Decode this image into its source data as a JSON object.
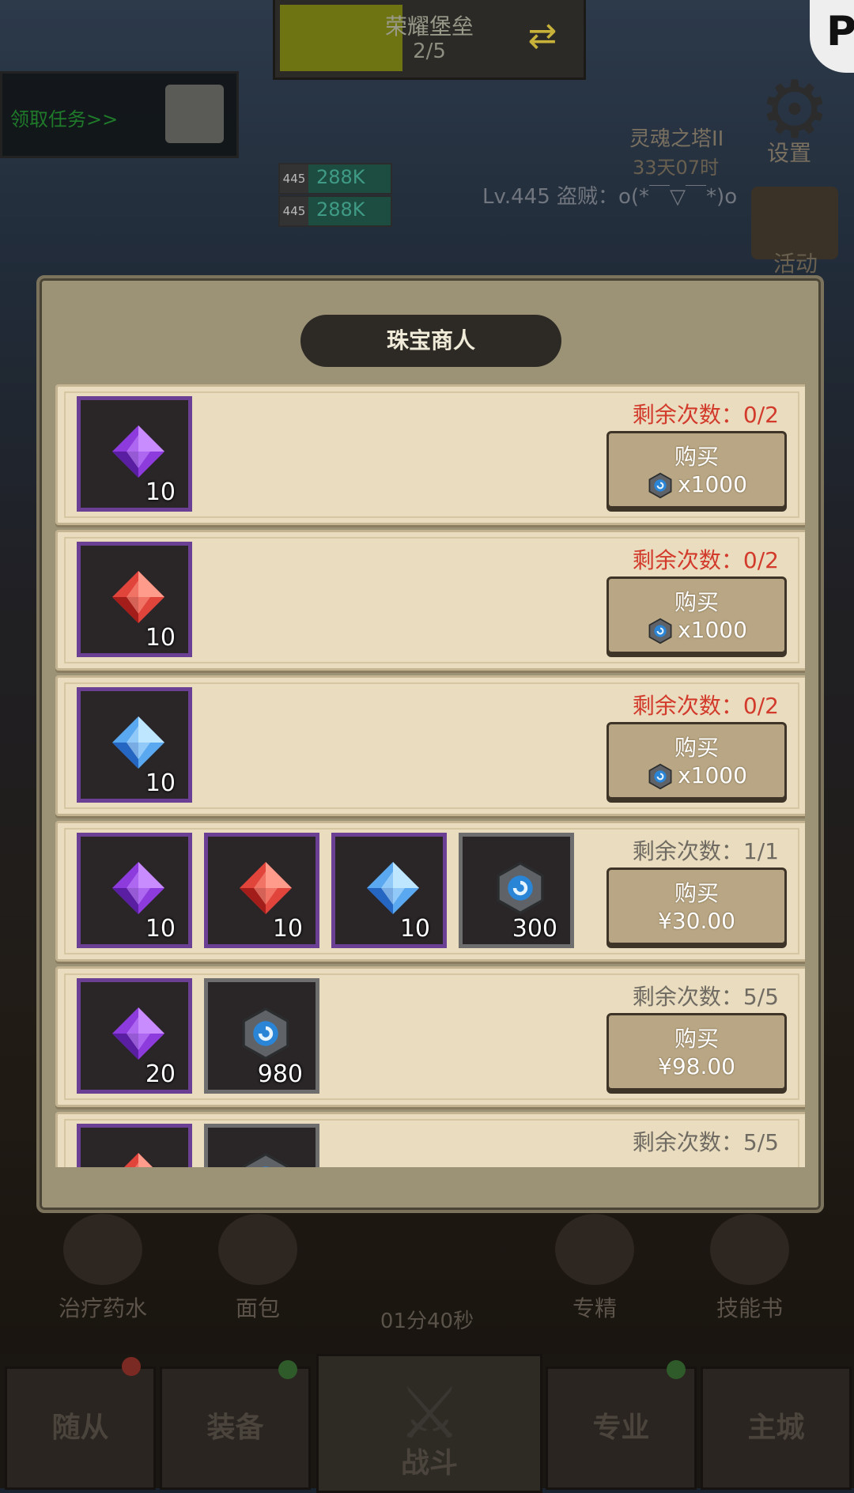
{
  "top": {
    "badge_name": "荣耀堡垒",
    "badge_progress": "2/5",
    "quest_text": "领取任务>>",
    "tower_name": "灵魂之塔II",
    "tower_time": "33天07时",
    "level_line": "Lv.445 盗贼：o(*￣▽￣*)o",
    "settings_label": "设置",
    "activity_label": "活动",
    "hp_bars": [
      {
        "level": "445",
        "value": "288K"
      },
      {
        "level": "445",
        "value": "288K"
      }
    ]
  },
  "modal": {
    "title": "珠宝商人",
    "rows": [
      {
        "items": [
          {
            "icon": "purple-gem-icon",
            "qty": "10"
          }
        ],
        "remain": "剩余次数：0/2",
        "buy_label": "购买",
        "price": "x1000",
        "price_type": "currency",
        "exhausted": true
      },
      {
        "items": [
          {
            "icon": "red-gem-icon",
            "qty": "10"
          }
        ],
        "remain": "剩余次数：0/2",
        "buy_label": "购买",
        "price": "x1000",
        "price_type": "currency",
        "exhausted": true
      },
      {
        "items": [
          {
            "icon": "blue-gem-icon",
            "qty": "10"
          }
        ],
        "remain": "剩余次数：0/2",
        "buy_label": "购买",
        "price": "x1000",
        "price_type": "currency",
        "exhausted": true
      },
      {
        "items": [
          {
            "icon": "purple-gem-icon",
            "qty": "10"
          },
          {
            "icon": "red-gem-icon",
            "qty": "10"
          },
          {
            "icon": "blue-gem-icon",
            "qty": "10"
          },
          {
            "icon": "coin-icon",
            "qty": "300"
          }
        ],
        "remain": "剩余次数：1/1",
        "buy_label": "购买",
        "price": "¥30.00",
        "price_type": "money",
        "exhausted": false
      },
      {
        "items": [
          {
            "icon": "purple-gem-icon",
            "qty": "20"
          },
          {
            "icon": "coin-icon",
            "qty": "980"
          }
        ],
        "remain": "剩余次数：5/5",
        "buy_label": "购买",
        "price": "¥98.00",
        "price_type": "money",
        "exhausted": false
      },
      {
        "items": [
          {
            "icon": "red-gem-icon",
            "qty": ""
          },
          {
            "icon": "coin-icon",
            "qty": ""
          }
        ],
        "remain": "剩余次数：5/5",
        "buy_label": "",
        "price": "",
        "price_type": "money",
        "exhausted": false
      }
    ]
  },
  "skills": [
    {
      "label": "治疗药水"
    },
    {
      "label": "面包"
    },
    {
      "label": "专精"
    },
    {
      "label": "技能书"
    }
  ],
  "timer": "01分40秒",
  "nav": {
    "tabs": [
      "随从",
      "装备",
      "战斗",
      "专业",
      "主城"
    ]
  },
  "colors": {
    "purple_frame": "#6b3f93",
    "remaining_red": "#d23a2b",
    "panel": "#9c9377",
    "row_bg": "#eadcbe"
  }
}
